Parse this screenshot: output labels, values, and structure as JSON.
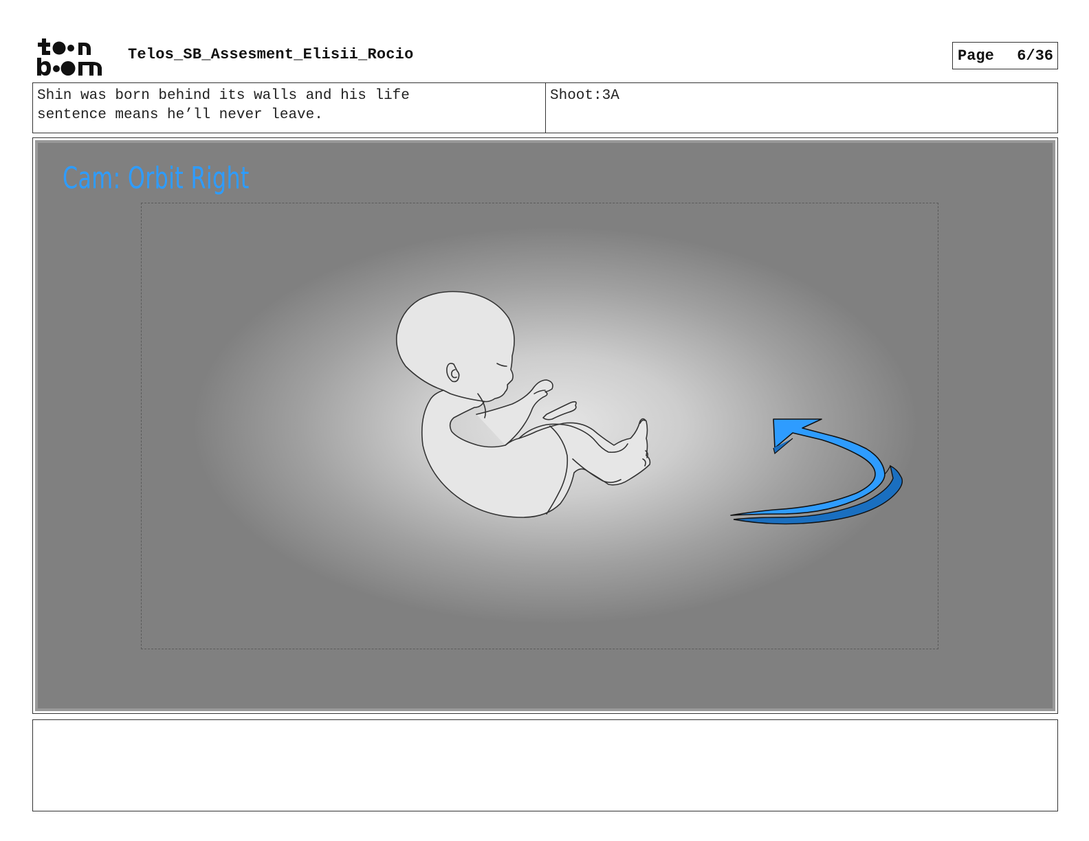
{
  "header": {
    "logo_text_top": "toon",
    "logo_text_bottom": "boom",
    "project_title": "Telos_SB_Assesment_Elisii_Rocio",
    "page_label": "Page",
    "page_number": "6/36"
  },
  "caption": {
    "dialogue": "Shin was born behind its walls and his life\nsentence means he’ll never leave.",
    "shoot": "Shoot:3A"
  },
  "panel": {
    "annotation": "Cam: Orbit Right",
    "annotation_color": "#2e9cff",
    "arrow_color": "#2e9cff",
    "subject_icon": "fetus-drawing",
    "arrow_icon": "curved-arrow"
  },
  "notes": {
    "text": ""
  }
}
